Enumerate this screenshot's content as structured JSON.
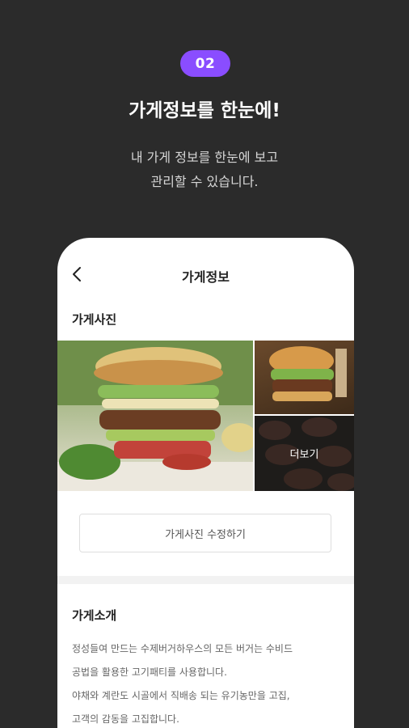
{
  "hero": {
    "step_badge": "02",
    "title": "가게정보를 한눈에!",
    "description_lines": [
      "내 가게 정보를 한눈에 보고",
      "관리할 수 있습니다."
    ]
  },
  "phone": {
    "header": {
      "title": "가게정보",
      "back_icon": "chevron-left-icon"
    },
    "photos_section": {
      "label": "가게사진",
      "more_label": "더보기",
      "edit_button_label": "가게사진 수정하기"
    },
    "intro_section": {
      "label": "가게소개",
      "lines": [
        "정성들여 만드는 수제버거하우스의 모든 버거는 수비드",
        "공법을 활용한 고기패티를 사용합니다.",
        "야채와 계란도 시골에서 직배송 되는 유기농만을 고집,",
        "고객의 감동을 고집합니다."
      ]
    }
  },
  "colors": {
    "background": "#2b2b2b",
    "accent": "#8a4dff",
    "phone_bg": "#ffffff"
  }
}
